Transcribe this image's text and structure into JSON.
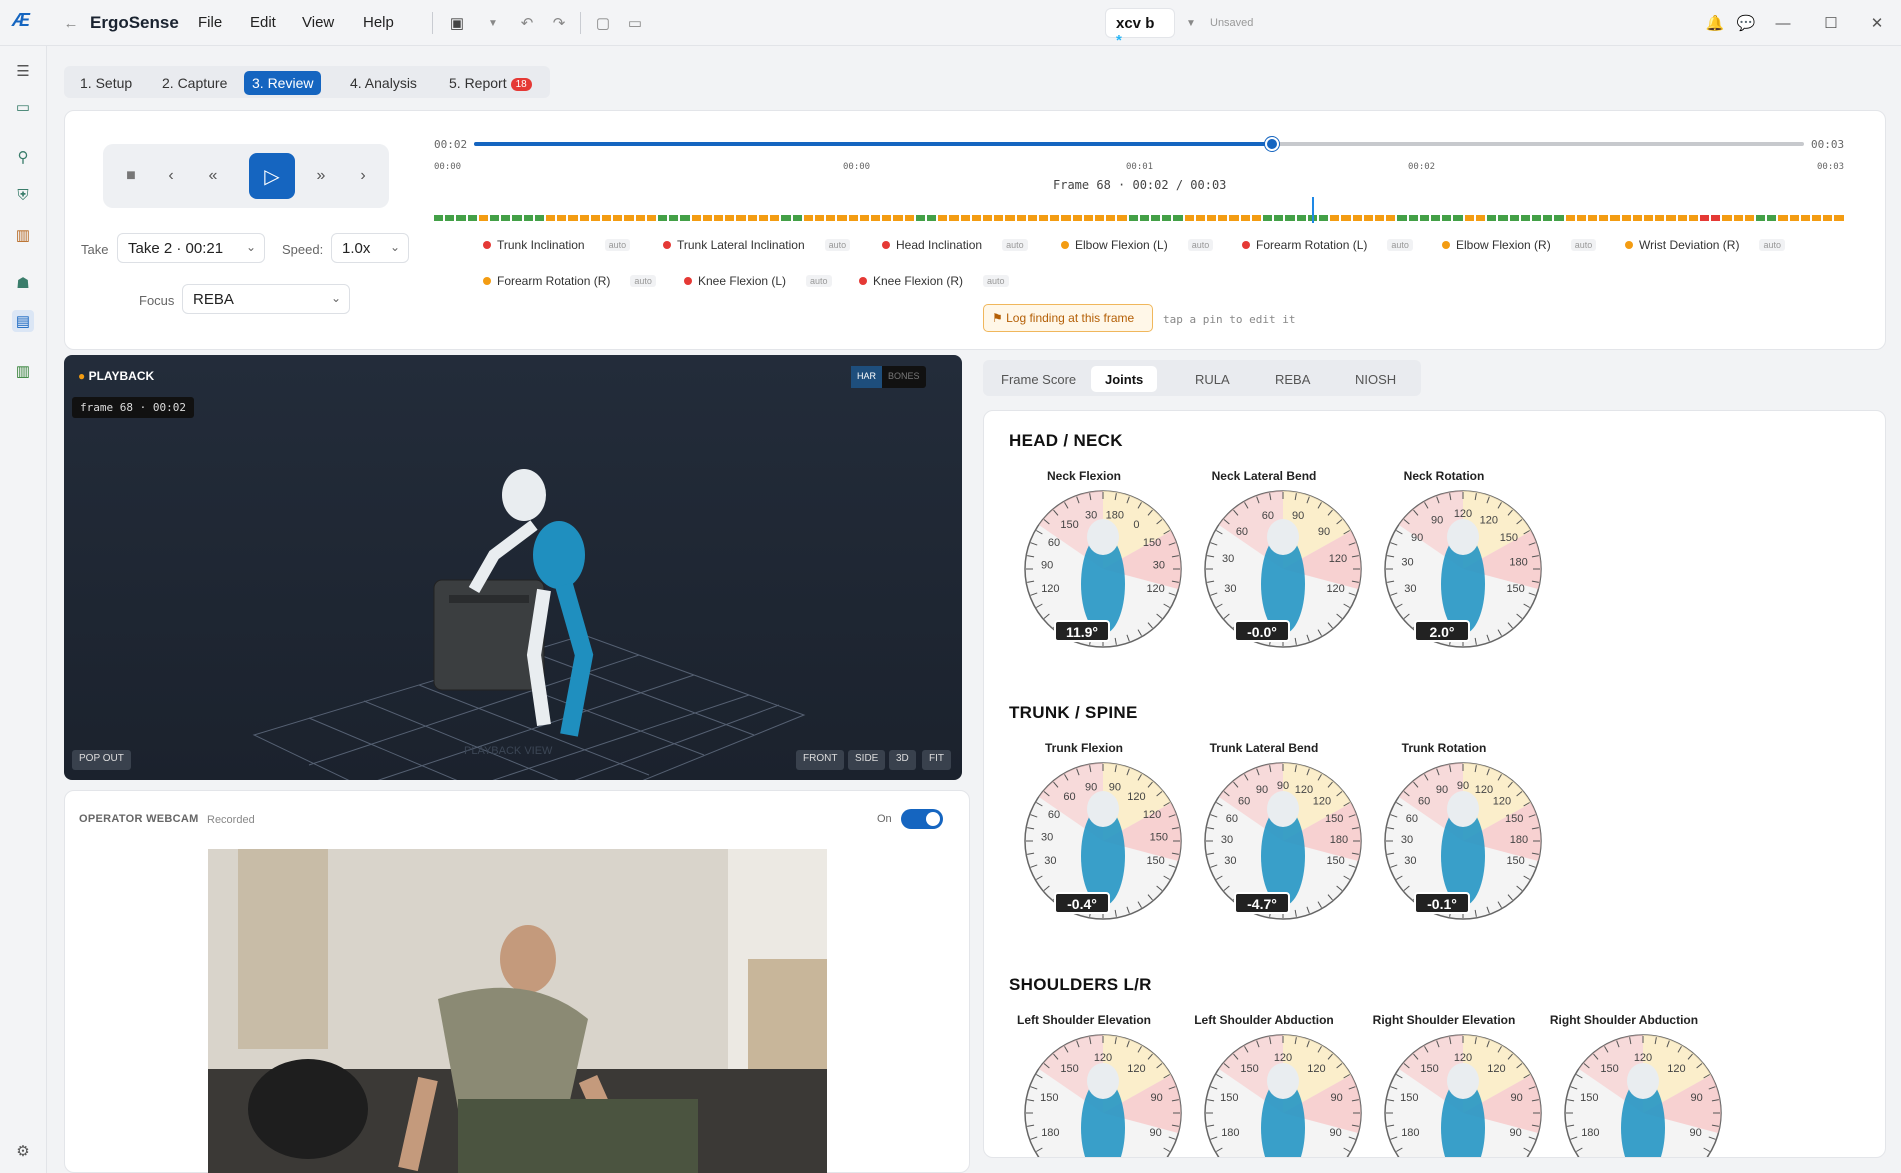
{
  "app": {
    "name": "ErgoSense",
    "menu": [
      "File",
      "Edit",
      "View",
      "Help"
    ],
    "file_name": "xcv b",
    "file_dirty": "*",
    "save_state": "Unsaved"
  },
  "steps": [
    {
      "label": "1. Setup"
    },
    {
      "label": "2. Capture"
    },
    {
      "label": "3. Review"
    },
    {
      "label": "4. Analysis"
    },
    {
      "label": "5. Report",
      "badge": "18"
    }
  ],
  "controls": {
    "take_label": "Take",
    "take_value": "Take 2 · 00:21",
    "speed_label": "Speed:",
    "speed_value": "1.0x",
    "focus_label": "Focus",
    "focus_value": "REBA"
  },
  "timeline": {
    "current": "00:02",
    "total": "00:03",
    "progress": 0.6,
    "ticks": [
      "00:00",
      "00:00",
      "00:01",
      "00:02",
      "00:03"
    ],
    "frame_text": "Frame 68 · 00:02 / 00:03",
    "risk": [
      "g",
      "g",
      "g",
      "g",
      "o",
      "g",
      "g",
      "g",
      "g",
      "g",
      "o",
      "o",
      "o",
      "o",
      "o",
      "o",
      "o",
      "o",
      "o",
      "o",
      "g",
      "g",
      "g",
      "o",
      "o",
      "o",
      "o",
      "o",
      "o",
      "o",
      "o",
      "g",
      "g",
      "o",
      "o",
      "o",
      "o",
      "o",
      "o",
      "o",
      "o",
      "o",
      "o",
      "g",
      "g",
      "o",
      "o",
      "o",
      "o",
      "o",
      "o",
      "o",
      "o",
      "o",
      "o",
      "o",
      "o",
      "o",
      "o",
      "o",
      "o",
      "o",
      "g",
      "g",
      "g",
      "g",
      "g",
      "o",
      "o",
      "o",
      "o",
      "o",
      "o",
      "o",
      "g",
      "g",
      "g",
      "g",
      "g",
      "g",
      "o",
      "o",
      "o",
      "o",
      "o",
      "o",
      "g",
      "g",
      "g",
      "g",
      "g",
      "g",
      "o",
      "o",
      "g",
      "g",
      "g",
      "g",
      "g",
      "g",
      "g",
      "o",
      "o",
      "o",
      "o",
      "o",
      "o",
      "o",
      "o",
      "o",
      "o",
      "o",
      "o",
      "r",
      "r",
      "o",
      "o",
      "o",
      "g",
      "g",
      "o",
      "o",
      "o",
      "o",
      "o",
      "o"
    ]
  },
  "legend": [
    {
      "name": "Trunk Inclination",
      "color": "#e53935"
    },
    {
      "name": "Trunk Lateral Inclination",
      "color": "#e53935"
    },
    {
      "name": "Head Inclination",
      "color": "#e53935"
    },
    {
      "name": "Elbow Flexion (L)",
      "color": "#f39c12"
    },
    {
      "name": "Forearm Rotation (L)",
      "color": "#e53935"
    },
    {
      "name": "Elbow Flexion (R)",
      "color": "#f39c12"
    },
    {
      "name": "Wrist Deviation (R)",
      "color": "#f39c12"
    },
    {
      "name": "Forearm Rotation (R)",
      "color": "#f39c12"
    },
    {
      "name": "Knee Flexion (L)",
      "color": "#e53935"
    },
    {
      "name": "Knee Flexion (R)",
      "color": "#e53935"
    }
  ],
  "legend_tag": "auto",
  "log_button": "⚑ Log finding at this frame",
  "log_hint": "tap a pin to edit it",
  "viewport": {
    "title": "PLAYBACK",
    "frame_label": "frame 68 · 00:02",
    "toggle_a": "HAR",
    "toggle_b": "BONES",
    "popout": "POP OUT",
    "views": [
      "FRONT",
      "SIDE",
      "3D",
      "FIT"
    ],
    "watermark": "PLAYBACK VIEW"
  },
  "webcam": {
    "title": "OPERATOR WEBCAM",
    "status": "Recorded",
    "toggle_label": "On"
  },
  "tabs": [
    "Frame Score",
    "Joints",
    "RULA",
    "REBA",
    "NIOSH"
  ],
  "joints": [
    {
      "section": "HEAD / NECK",
      "gauges": [
        {
          "name": "Neck Flexion",
          "value": "11.9°",
          "labels": [
            "120",
            "90",
            "60",
            "150",
            "30",
            "180",
            "0",
            "150",
            "30",
            "120"
          ]
        },
        {
          "name": "Neck Lateral Bend",
          "value": "-0.0°",
          "labels": [
            "30",
            "30",
            "60",
            "60",
            "90",
            "90",
            "120",
            "120"
          ]
        },
        {
          "name": "Neck Rotation",
          "value": "2.0°",
          "labels": [
            "30",
            "30",
            "90",
            "90",
            "120",
            "120",
            "150",
            "180",
            "150"
          ]
        }
      ]
    },
    {
      "section": "TRUNK / SPINE",
      "gauges": [
        {
          "name": "Trunk Flexion",
          "value": "-0.4°",
          "labels": [
            "30",
            "30",
            "60",
            "60",
            "90",
            "90",
            "120",
            "120",
            "150",
            "150"
          ]
        },
        {
          "name": "Trunk Lateral Bend",
          "value": "-4.7°",
          "labels": [
            "30",
            "30",
            "60",
            "60",
            "90",
            "90",
            "120",
            "120",
            "150",
            "180",
            "150"
          ]
        },
        {
          "name": "Trunk Rotation",
          "value": "-0.1°",
          "labels": [
            "30",
            "30",
            "60",
            "60",
            "90",
            "90",
            "120",
            "120",
            "150",
            "180",
            "150"
          ]
        }
      ]
    },
    {
      "section": "SHOULDERS L/R",
      "gauges": [
        {
          "name": "Left Shoulder Elevation",
          "value": "",
          "labels": [
            "180",
            "150",
            "150",
            "120",
            "120",
            "90",
            "90"
          ]
        },
        {
          "name": "Left Shoulder Abduction",
          "value": "",
          "labels": [
            "180",
            "150",
            "150",
            "120",
            "120",
            "90",
            "90"
          ]
        },
        {
          "name": "Right Shoulder Elevation",
          "value": "",
          "labels": [
            "180",
            "150",
            "150",
            "120",
            "120",
            "90",
            "90"
          ]
        },
        {
          "name": "Right Shoulder Abduction",
          "value": "",
          "labels": [
            "180",
            "150",
            "150",
            "120",
            "120",
            "90",
            "90"
          ]
        }
      ]
    }
  ]
}
